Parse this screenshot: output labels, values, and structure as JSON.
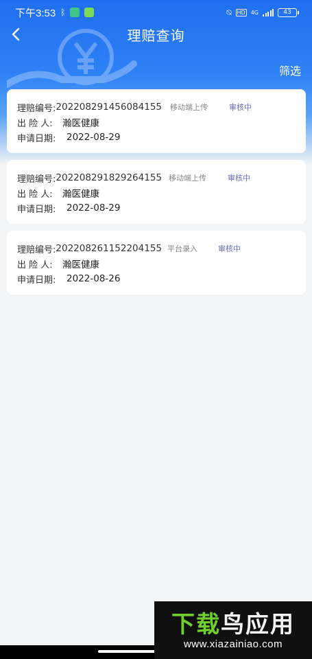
{
  "status_bar": {
    "time": "下午3:53",
    "network": "4G",
    "battery": "43"
  },
  "nav": {
    "title": "理赔查询",
    "filter_label": "筛选"
  },
  "claims": [
    {
      "claim_no_label": "理赔编号:",
      "claim_no": "202208291456084155",
      "source": "移动端上传",
      "status": "审核中",
      "insured_label": "出 险 人:",
      "insured": "瀚医健康",
      "date_label": "申请日期:",
      "date": "2022-08-29"
    },
    {
      "claim_no_label": "理赔编号:",
      "claim_no": "202208291829264155",
      "source": "移动端上传",
      "status": "审核中",
      "insured_label": "出 险 人:",
      "insured": "瀚医健康",
      "date_label": "申请日期:",
      "date": "2022-08-29"
    },
    {
      "claim_no_label": "理赔编号:",
      "claim_no": "202208261152204155",
      "source": "平台录入",
      "status": "审核中",
      "insured_label": "出 险 人:",
      "insured": "瀚医健康",
      "date_label": "申请日期:",
      "date": "2022-08-26"
    }
  ],
  "watermark": {
    "title_green": "下载",
    "title_white": "鸟应用",
    "url": "www.xiazainiao.com"
  },
  "colors": {
    "header_blue": "#1f6ef0",
    "status_purple": "#6a6fc7",
    "watermark_green": "#6fcf2c"
  }
}
